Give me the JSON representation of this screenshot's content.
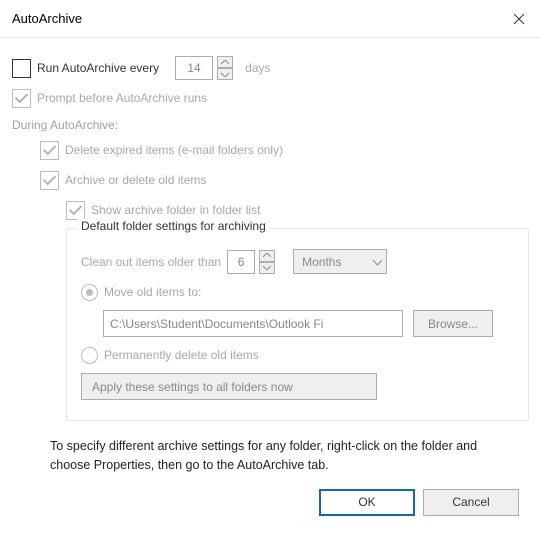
{
  "title": "AutoArchive",
  "run_every": {
    "checkbox_label": "Run AutoArchive every",
    "value": "14",
    "unit": "days",
    "checked": false
  },
  "prompt": {
    "label": "Prompt before AutoArchive runs",
    "checked": true
  },
  "during_heading": "During AutoArchive:",
  "delete_expired": {
    "label": "Delete expired items (e-mail folders only)",
    "checked": true
  },
  "archive_delete": {
    "label": "Archive or delete old items",
    "checked": true
  },
  "show_folder": {
    "label": "Show archive folder in folder list",
    "checked": true
  },
  "group": {
    "caption": "Default folder settings for archiving",
    "clean_label": "Clean out items older than",
    "clean_value": "6",
    "clean_unit": "Months",
    "move": {
      "label": "Move old items to:",
      "path": "C:\\Users\\Student\\Documents\\Outlook Fi",
      "browse": "Browse...",
      "selected": true
    },
    "perm_delete": {
      "label": "Permanently delete old items",
      "selected": false
    },
    "apply_all": "Apply these settings to all folders now"
  },
  "footer": "To specify different archive settings for any folder, right-click on the folder and choose Properties, then go to the AutoArchive tab.",
  "buttons": {
    "ok": "OK",
    "cancel": "Cancel"
  }
}
